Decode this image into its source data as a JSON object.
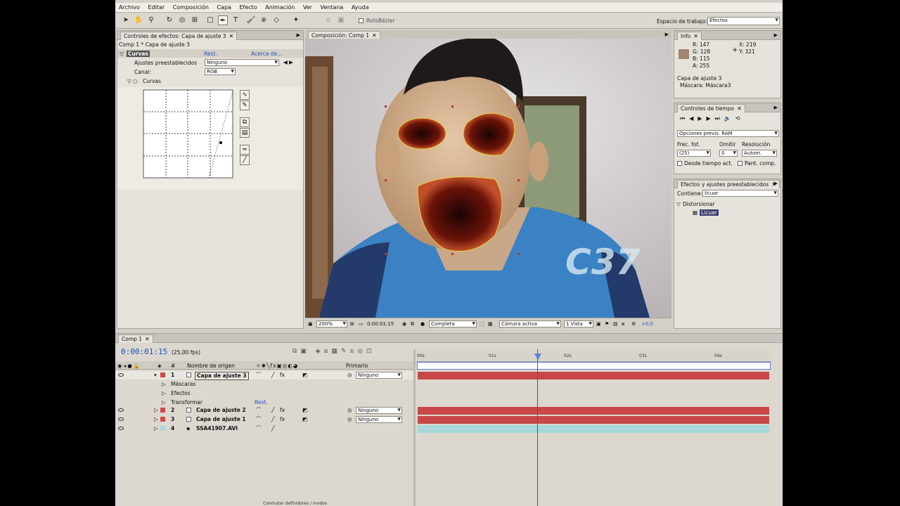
{
  "menubar": [
    "Archivo",
    "Editar",
    "Composición",
    "Capa",
    "Efecto",
    "Animación",
    "Ver",
    "Ventana",
    "Ayuda"
  ],
  "toolbar": {
    "rotobezier": "RotoBézier",
    "workspace_label": "Espacio de trabajo:",
    "workspace_value": "Efectos"
  },
  "effects_panel": {
    "tab": "Controles de efectos: Capa de ajuste 3",
    "breadcrumb": "Comp 1 * Capa de ajuste 3",
    "effect_name": "Curvas",
    "reset": "Rest.",
    "about": "Acerca de...",
    "preset_label": "Ajustes preestablecidos",
    "preset_value": "Ninguno",
    "channel_label": "Canal:",
    "channel_value": "RGB",
    "curves_label": "Curvas"
  },
  "comp_panel": {
    "tab": "Composición: Comp 1",
    "zoom": "200%",
    "timecode": "0:00:01:15",
    "resolution": "Completa",
    "camera": "Cámara activa",
    "views": "1 Vista",
    "offset": "+0,0"
  },
  "info_panel": {
    "tab": "Info",
    "r": "R: 147",
    "g": "G: 128",
    "b": "B: 115",
    "a": "A: 255",
    "x": "X: 219",
    "y": "Y: 321",
    "layer": "Capa de ajuste 3",
    "mask": "Máscara: Máscara3",
    "swatch": "#a08572"
  },
  "time_controls": {
    "tab": "Controles de tiempo",
    "ram": "Opciones previs. RAM",
    "frame_rate_label": "Frec. fot.",
    "skip_label": "Omitir",
    "resolution_label": "Resolución",
    "frame_rate": "(25)",
    "skip": "0",
    "resolution": "Autom.",
    "from_current": "Desde tiempo act.",
    "full_screen": "Pant. comp."
  },
  "effects_presets": {
    "tab": "Efectos y ajustes preestablecidos",
    "contains_label": "Contiene:",
    "search": "licuar",
    "category": "Distorsionar",
    "item": "Licuar"
  },
  "timeline": {
    "tab": "Comp 1",
    "timecode": "0:00:01:15",
    "fps": "(25,00 fps)",
    "col_num": "#",
    "col_source": "Nombre de origen",
    "col_parent": "Primario",
    "ruler": [
      "00s",
      "01s",
      "02s",
      "03s",
      "04s"
    ],
    "layers": [
      {
        "num": "1",
        "name": "Capa de ajuste 3",
        "parent": "Ninguno",
        "color": "#d04848"
      },
      {
        "num": "2",
        "name": "Capa de ajuste 2",
        "parent": "Ninguno",
        "color": "#d04848"
      },
      {
        "num": "3",
        "name": "Capa de ajuste 1",
        "parent": "Ninguno",
        "color": "#d04848"
      },
      {
        "num": "4",
        "name": "SSA41907.AVI",
        "parent": "Ninguno",
        "color": "#a8d8d8"
      }
    ],
    "sub": {
      "masks": "Máscaras",
      "effects": "Efectos",
      "transform": "Transformar",
      "reset": "Rest."
    },
    "footer": "Conmutar definidores / modos"
  }
}
